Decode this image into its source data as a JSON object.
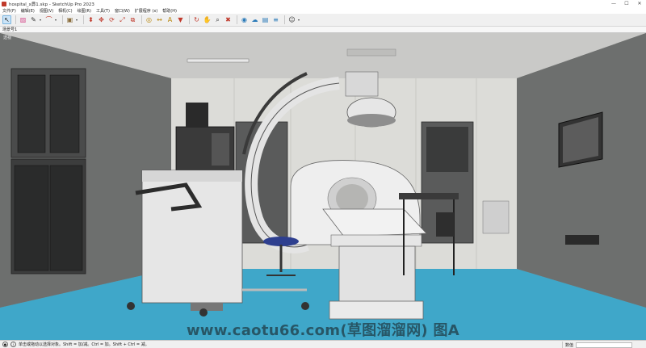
{
  "window": {
    "title": "hospital_x丳1.skp - SketchUp Pro 2023",
    "controls": {
      "minimize": "—",
      "maximize": "☐",
      "close": "✕"
    }
  },
  "menu": [
    "文件(F)",
    "编辑(E)",
    "视图(V)",
    "相机(C)",
    "绘图(R)",
    "工具(T)",
    "窗口(W)",
    "扩展程序 (x)",
    "帮助(H)"
  ],
  "toolbar": {
    "tools": [
      {
        "name": "select-icon",
        "glyph": "↖",
        "active": true
      },
      {
        "name": "eraser-icon",
        "glyph": "▨",
        "color": "#d64f8e"
      },
      {
        "name": "pencil-icon",
        "glyph": "✎",
        "color": "#333333"
      },
      {
        "name": "arc-icon",
        "glyph": "⌒",
        "color": "#c0392b"
      },
      {
        "name": "rectangle-icon",
        "glyph": "▣",
        "color": "#8a6d3b"
      },
      {
        "name": "push-pull-icon",
        "glyph": "⬍",
        "color": "#c0392b"
      },
      {
        "name": "move-icon",
        "glyph": "✥",
        "color": "#c0392b"
      },
      {
        "name": "rotate-icon",
        "glyph": "⟳",
        "color": "#c0392b"
      },
      {
        "name": "scale-icon",
        "glyph": "⤢",
        "color": "#c0392b"
      },
      {
        "name": "offset-icon",
        "glyph": "⧉",
        "color": "#c0392b"
      },
      {
        "name": "tape-measure-icon",
        "glyph": "◎",
        "color": "#b8860b"
      },
      {
        "name": "dimension-icon",
        "glyph": "↔",
        "color": "#b8860b"
      },
      {
        "name": "text-icon",
        "glyph": "A",
        "color": "#b8860b"
      },
      {
        "name": "paint-bucket-icon",
        "glyph": "▼",
        "color": "#c0392b"
      },
      {
        "name": "orbit-icon",
        "glyph": "↻",
        "color": "#c0392b"
      },
      {
        "name": "pan-icon",
        "glyph": "✋",
        "color": "#b8860b"
      },
      {
        "name": "zoom-icon",
        "glyph": "⌕",
        "color": "#333333"
      },
      {
        "name": "zoom-extents-icon",
        "glyph": "✖",
        "color": "#c0392b"
      },
      {
        "name": "geo-location-icon",
        "glyph": "◉",
        "color": "#2a7ab8"
      },
      {
        "name": "warehouse-icon",
        "glyph": "☁",
        "color": "#2a7ab8"
      },
      {
        "name": "extension-warehouse-icon",
        "glyph": "▤",
        "color": "#2a7ab8"
      },
      {
        "name": "layout-icon",
        "glyph": "≡",
        "color": "#2a7ab8"
      },
      {
        "name": "account-icon",
        "glyph": "☺",
        "color": "#333333"
      }
    ]
  },
  "scenes": {
    "label": "场景号1"
  },
  "viewport": {
    "camera_label": "透视"
  },
  "watermark": "www.caotu66.com(草图溜溜网) 图A",
  "status": {
    "hint": "单击或拖动以选择对象。Shift = 加/减。Ctrl = 加。Shift + Ctrl = 减。",
    "measure_label": "数值",
    "measure_value": ""
  },
  "colors": {
    "floor": "#3fa7c9",
    "ceiling": "#c9c9c7",
    "back_wall": "#dcdcd8",
    "side_wall": "#6d6f6e",
    "equipment_white": "#eeeeee",
    "equipment_dark": "#3a3a3a"
  }
}
